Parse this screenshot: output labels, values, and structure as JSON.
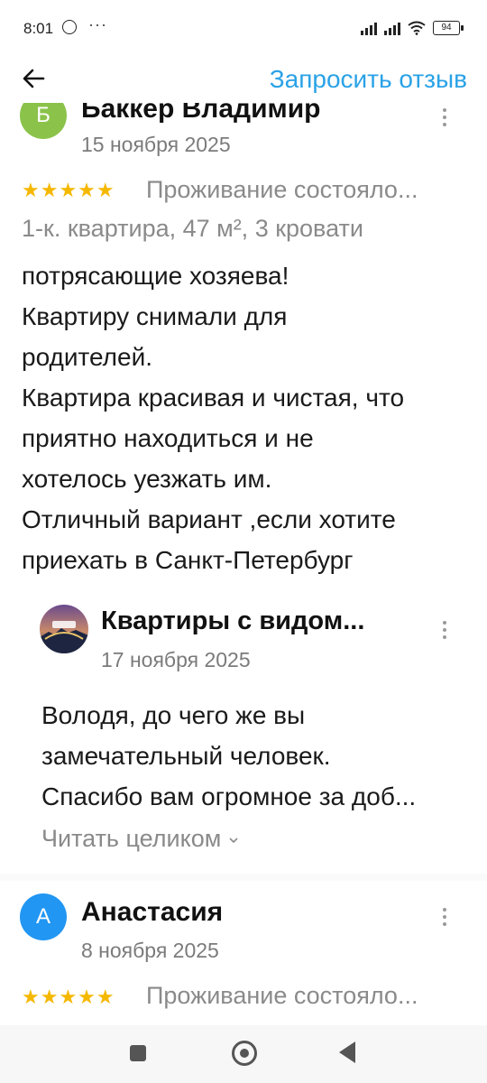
{
  "status_bar": {
    "time": "8:01",
    "dots": "···",
    "battery": "94"
  },
  "toolbar": {
    "request_review": "Запросить отзыв"
  },
  "reviews": [
    {
      "author": "Баккер Владимир",
      "avatar_letter": "Б",
      "avatar_color": "#8bc34a",
      "date": "15 ноября 2025",
      "stars": "★★★★★",
      "rating_text": "Проживание состояло...",
      "meta": "1-к. квартира, 47 м², 3 кровати",
      "body_lines": [
        "потрясающие хозяева!",
        "Квартиру снимали для",
        "родителей.",
        "Квартира красивая и чистая, что",
        "приятно находиться и не",
        "хотелось уезжать им.",
        "Отличный вариант ,если хотите",
        "приехать в Санкт-Петербург"
      ],
      "reply": {
        "author": "Квартиры с видом...",
        "date": "17 ноября 2025",
        "lines": [
          "Володя, до чего же вы",
          "замечательный человек.",
          "Спасибо вам огромное за доб..."
        ],
        "read_more": "Читать целиком"
      }
    },
    {
      "author": "Анастасия",
      "avatar_letter": "А",
      "avatar_color": "#2196f3",
      "date": "8 ноября 2025",
      "stars": "★★★★★",
      "rating_text": "Проживание состояло..."
    }
  ]
}
